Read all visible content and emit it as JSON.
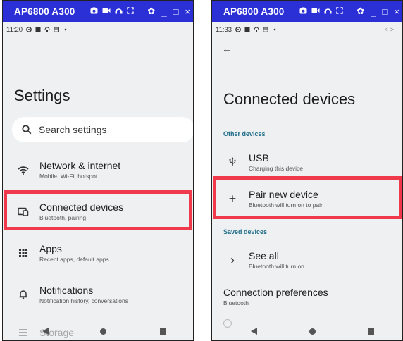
{
  "window_title": "AP6800 A300",
  "window_controls": {
    "gear": "✿",
    "minimize": "_",
    "maximize": "□",
    "close": "×"
  },
  "left": {
    "status_time": "11:20",
    "title": "Settings",
    "search_placeholder": "Search settings",
    "items": [
      {
        "title": "Network & internet",
        "subtitle": "Mobile, Wi-Fi, hotspot",
        "icon": "wifi-icon"
      },
      {
        "title": "Connected devices",
        "subtitle": "Bluetooth, pairing",
        "icon": "connected-devices-icon"
      },
      {
        "title": "Apps",
        "subtitle": "Recent apps, default apps",
        "icon": "apps-grid-icon"
      },
      {
        "title": "Notifications",
        "subtitle": "Notification history, conversations",
        "icon": "bell-icon"
      },
      {
        "title": "Storage",
        "subtitle": "",
        "icon": "storage-icon"
      }
    ]
  },
  "right": {
    "status_time": "11:33",
    "status_right": "<·>",
    "back": "←",
    "title": "Connected devices",
    "section_other": "Other devices",
    "usb": {
      "title": "USB",
      "subtitle": "Charging this device"
    },
    "pair": {
      "title": "Pair new device",
      "subtitle": "Bluetooth will turn on to pair",
      "icon_glyph": "+"
    },
    "section_saved": "Saved devices",
    "see_all": {
      "title": "See all",
      "subtitle": "Bluetooth will turn on",
      "icon_glyph": "›"
    },
    "prefs": {
      "title": "Connection preferences",
      "subtitle": "Bluetooth"
    }
  },
  "colors": {
    "titlebar": "#2a2fd6",
    "highlight": "#f03a4b",
    "section": "#1f6d8a",
    "panel_bg": "#eef0f1"
  }
}
